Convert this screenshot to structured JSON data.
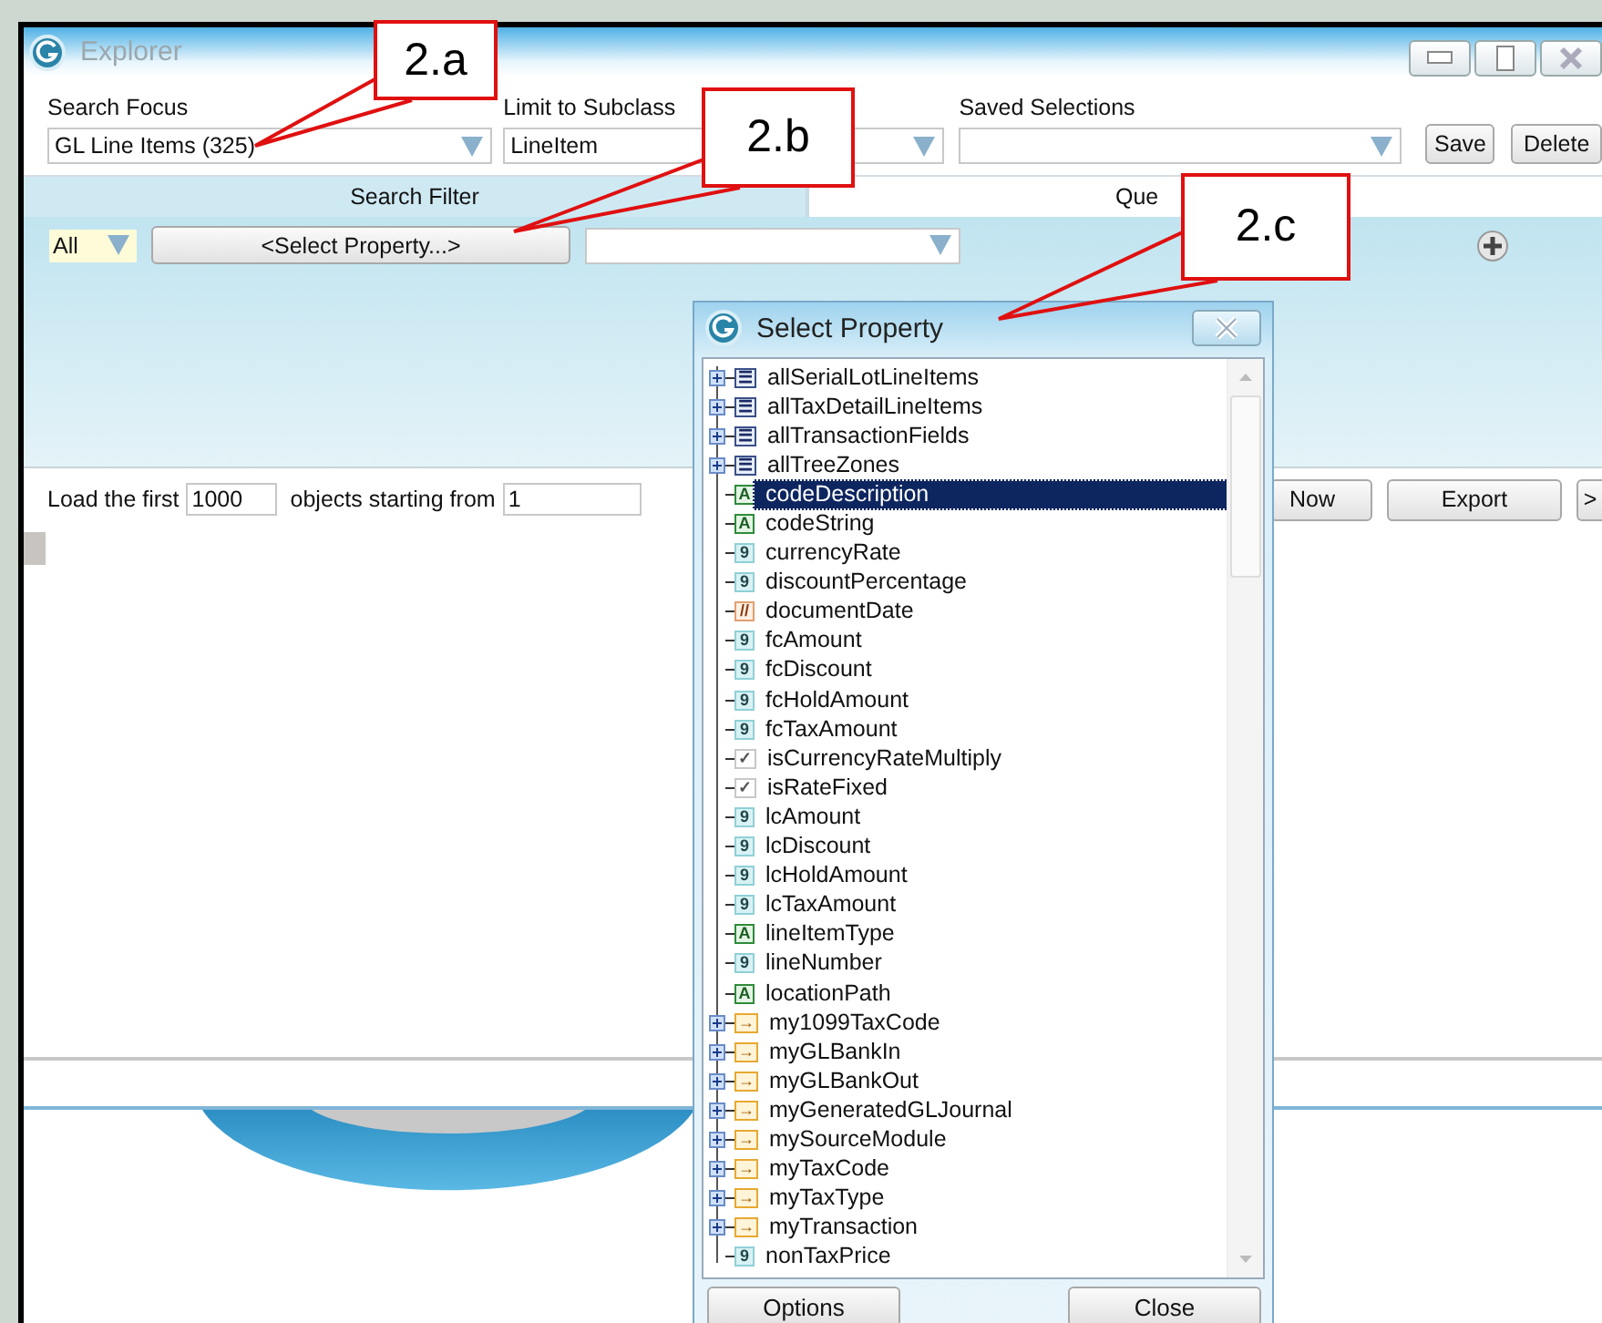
{
  "window": {
    "title": "Explorer",
    "active": false
  },
  "search_focus": {
    "label": "Search Focus",
    "value": "GL Line Items (325)"
  },
  "limit_to_subclass": {
    "label": "Limit to Subclass",
    "value": "LineItem"
  },
  "saved_selections": {
    "label": "Saved Selections"
  },
  "buttons": [
    "Save",
    "Delete"
  ],
  "tabs": [
    {
      "label": "Search Filter",
      "selected": true
    },
    {
      "label": "Que",
      "selected": false
    }
  ],
  "filter": {
    "match": "All",
    "property_button": "<Select Property...>"
  },
  "load": {
    "prefix": "Load the first",
    "count": "1000",
    "middle": "objects starting from",
    "start": "1"
  },
  "load_buttons": [
    "Now",
    "Export",
    ">"
  ],
  "dialog": {
    "title": "Select Property",
    "buttons": [
      "Options",
      "Close"
    ],
    "items": [
      {
        "kind": "collection",
        "icon": "☰",
        "label": "allSerialLotLineItems",
        "expandable": true,
        "selected": false
      },
      {
        "kind": "collection",
        "icon": "☰",
        "label": "allTaxDetailLineItems",
        "expandable": true,
        "selected": false
      },
      {
        "kind": "collection",
        "icon": "☰",
        "label": "allTransactionFields",
        "expandable": true,
        "selected": false
      },
      {
        "kind": "collection",
        "icon": "☰",
        "label": "allTreeZones",
        "expandable": true,
        "selected": false
      },
      {
        "kind": "string",
        "icon": "A",
        "label": "codeDescription",
        "expandable": false,
        "selected": true
      },
      {
        "kind": "string",
        "icon": "A",
        "label": "codeString",
        "expandable": false,
        "selected": false
      },
      {
        "kind": "number",
        "icon": "9",
        "label": "currencyRate",
        "expandable": false,
        "selected": false
      },
      {
        "kind": "number",
        "icon": "9",
        "label": "discountPercentage",
        "expandable": false,
        "selected": false
      },
      {
        "kind": "date",
        "icon": "//",
        "label": "documentDate",
        "expandable": false,
        "selected": false
      },
      {
        "kind": "number",
        "icon": "9",
        "label": "fcAmount",
        "expandable": false,
        "selected": false
      },
      {
        "kind": "number",
        "icon": "9",
        "label": "fcDiscount",
        "expandable": false,
        "selected": false
      },
      {
        "kind": "number",
        "icon": "9",
        "label": "fcHoldAmount",
        "expandable": false,
        "selected": false
      },
      {
        "kind": "number",
        "icon": "9",
        "label": "fcTaxAmount",
        "expandable": false,
        "selected": false
      },
      {
        "kind": "boolean",
        "icon": "✓",
        "label": "isCurrencyRateMultiply",
        "expandable": false,
        "selected": false
      },
      {
        "kind": "boolean",
        "icon": "✓",
        "label": "isRateFixed",
        "expandable": false,
        "selected": false
      },
      {
        "kind": "number",
        "icon": "9",
        "label": "lcAmount",
        "expandable": false,
        "selected": false
      },
      {
        "kind": "number",
        "icon": "9",
        "label": "lcDiscount",
        "expandable": false,
        "selected": false
      },
      {
        "kind": "number",
        "icon": "9",
        "label": "lcHoldAmount",
        "expandable": false,
        "selected": false
      },
      {
        "kind": "number",
        "icon": "9",
        "label": "lcTaxAmount",
        "expandable": false,
        "selected": false
      },
      {
        "kind": "string",
        "icon": "A",
        "label": "lineItemType",
        "expandable": false,
        "selected": false
      },
      {
        "kind": "number",
        "icon": "9",
        "label": "lineNumber",
        "expandable": false,
        "selected": false
      },
      {
        "kind": "string",
        "icon": "A",
        "label": "locationPath",
        "expandable": false,
        "selected": false
      },
      {
        "kind": "reference",
        "icon": "→",
        "label": "my1099TaxCode",
        "expandable": true,
        "selected": false
      },
      {
        "kind": "reference",
        "icon": "→",
        "label": "myGLBankIn",
        "expandable": true,
        "selected": false
      },
      {
        "kind": "reference",
        "icon": "→",
        "label": "myGLBankOut",
        "expandable": true,
        "selected": false
      },
      {
        "kind": "reference",
        "icon": "→",
        "label": "myGeneratedGLJournal",
        "expandable": true,
        "selected": false
      },
      {
        "kind": "reference",
        "icon": "→",
        "label": "mySourceModule",
        "expandable": true,
        "selected": false
      },
      {
        "kind": "reference",
        "icon": "→",
        "label": "myTaxCode",
        "expandable": true,
        "selected": false
      },
      {
        "kind": "reference",
        "icon": "→",
        "label": "myTaxType",
        "expandable": true,
        "selected": false
      },
      {
        "kind": "reference",
        "icon": "→",
        "label": "myTransaction",
        "expandable": true,
        "selected": false
      },
      {
        "kind": "number",
        "icon": "9",
        "label": "nonTaxPrice",
        "expandable": false,
        "selected": false
      }
    ]
  },
  "callouts": [
    {
      "label": "2.a"
    },
    {
      "label": "2.b"
    },
    {
      "label": "2.c"
    }
  ]
}
